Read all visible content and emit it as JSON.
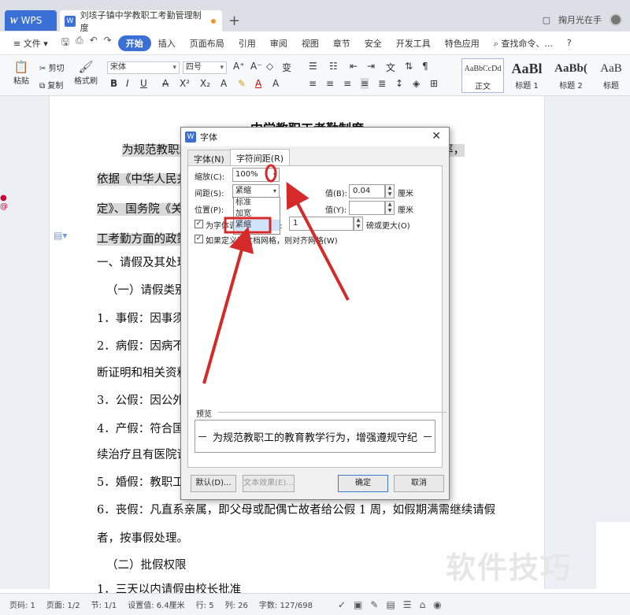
{
  "titlebar": {
    "app_name": "WPS",
    "doc_tab": "刘垓子镇中学教职工考勤管理制度",
    "new_tab": "+",
    "user": "掬月光在手"
  },
  "menu": {
    "file": "文件",
    "items": [
      "开始",
      "插入",
      "页面布局",
      "引用",
      "审阅",
      "视图",
      "章节",
      "安全",
      "开发工具",
      "特色应用"
    ],
    "search": "查找命令、..."
  },
  "ribbon": {
    "paste": "粘贴",
    "cut": "剪切",
    "copy": "复制",
    "format_painter": "格式刷",
    "font_name": "宋体",
    "font_size": "四号",
    "styles": [
      {
        "sample": "AaBbCcDd",
        "label": "正文"
      },
      {
        "sample": "AaBl",
        "label": "标题 1"
      },
      {
        "sample": "AaBb(",
        "label": "标题 2"
      },
      {
        "sample": "AaB",
        "label": "标题"
      }
    ]
  },
  "document": {
    "title": "中学教职工考勤制度",
    "lines": [
      "为规范教职工的教育教学行为，增强遵规守纪意识，提高工作效率，",
      "依据《中华人民共和国教师法》、《国务院关于教师生活待遇的规",
      "定》、国务院《关于职工探亲待遇的规定》及上级有关部门有关教职",
      "工考勤方面的政策，结合本校实际，特制定本制度。",
      "一、请假及其处理",
      "（一）请假类别",
      "1．事假：因事须离开工作岗位的，须履行请假手续。",
      "2．病假：因病不能坚持工作的，凭医生证明请病假，须持县医院诊",
      "断证明和相关资料。",
      "3．公假：因公外出参加会议、学习、培训等。",
      "4．产假：符合国家生育政策的，按规定给予产假，期满因病需继",
      "续治疗且有医院证明的，按病假处理。",
      "5．婚假：教职工结婚的，按规定给予婚假。",
      "6．丧假：凡直系亲属，即父母或配偶亡故者给公假 1 周，如假期满需继续请假",
      "者，按事假处理。",
      "（二）批假权限",
      "1．三天以内请假由校长批准"
    ]
  },
  "dialog": {
    "title": "字体",
    "tabs": [
      "字体(N)",
      "字符间距(R)"
    ],
    "scale_label": "缩放(C):",
    "scale_value": "100%",
    "spacing_label": "间距(S):",
    "spacing_value": "紧缩",
    "spacing_options": [
      "标准",
      "加宽",
      "紧缩"
    ],
    "value_b_label": "值(B):",
    "value_b": "0.04",
    "unit_cm": "厘米",
    "position_label": "位置(P):",
    "value_y_label": "值(Y):",
    "value_y": "",
    "kerning_label": "为字体调整字间距(K):",
    "kerning_value": "1",
    "kerning_suffix": "磅或更大(O)",
    "grid_label": "如果定义了文档网格，则对齐网格(W)",
    "preview_label": "预览",
    "preview_text": "为规范教职工的教育教学行为，增强遵规守纪",
    "btn_default": "默认(D)...",
    "btn_text_effects": "文本效果(E)...",
    "btn_ok": "确定",
    "btn_cancel": "取消"
  },
  "statusbar": {
    "page": "页码: 1",
    "pages": "页面: 1/2",
    "section": "节: 1/1",
    "setting": "设置值: 6.4厘米",
    "row": "行: 5",
    "col": "列: 26",
    "words": "字数: 127/698"
  },
  "watermark": "软件技巧",
  "colors": {
    "accent": "#3a6fd6",
    "annotation": "#d42a2a"
  }
}
